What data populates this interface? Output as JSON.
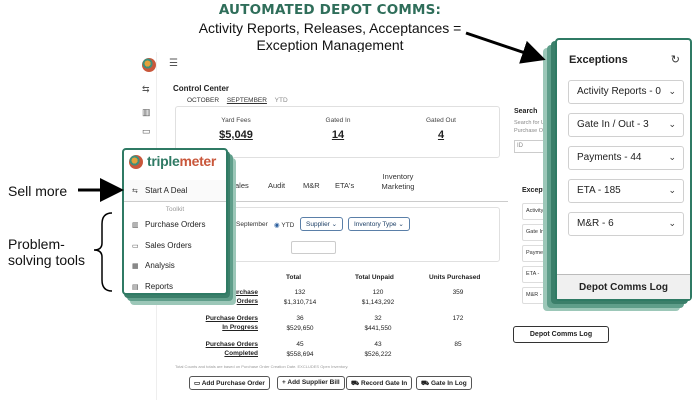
{
  "headline": {
    "title": "AUTOMATED DEPOT COMMS:",
    "line1": "Activity Reports, Releases, Acceptances =",
    "line2": "Exception Management"
  },
  "annotations": {
    "sell_more": "Sell more",
    "problem_line1": "Problem-",
    "problem_line2": "solving tools"
  },
  "colors": {
    "brand": "#2f7a64",
    "headline": "#2f6e5a",
    "accent_blue": "#5a7fa8"
  },
  "control_center": {
    "title": "Control Center",
    "period_tabs": [
      "OCTOBER",
      "SEPTEMBER",
      "YTD"
    ],
    "kpis": [
      {
        "label": "Yard Fees",
        "value": "$5,049"
      },
      {
        "label": "Gated In",
        "value": "14"
      },
      {
        "label": "Gated Out",
        "value": "4"
      }
    ],
    "tabs": [
      "Sales",
      "Audit",
      "M&R",
      "ETA's",
      "Inventory",
      "Marketing"
    ],
    "filters": {
      "radio_1": "September",
      "radio_2": "YTD",
      "dropdown_1": "Supplier",
      "dropdown_2": "Inventory Type"
    },
    "table": {
      "headers": [
        "Total",
        "Total Unpaid",
        "Units Purchased"
      ],
      "rows": [
        {
          "label_1": "Purchase",
          "label_2": "Orders",
          "total_count": "132",
          "total_amount": "$1,310,714",
          "unpaid_count": "120",
          "unpaid_amount": "$1,143,292",
          "units": "359"
        },
        {
          "label_1": "Purchase Orders",
          "label_2": "In Progress",
          "total_count": "36",
          "total_amount": "$529,650",
          "unpaid_count": "32",
          "unpaid_amount": "$441,550",
          "units": "172"
        },
        {
          "label_1": "Purchase Orders",
          "label_2": "Completed",
          "total_count": "45",
          "total_amount": "$558,694",
          "unpaid_count": "43",
          "unpaid_amount": "$526,222",
          "units": "85"
        }
      ],
      "note": "Total Counts and totals are based on Purchase Order Creation Date. EXCLUDES Open Inventory."
    },
    "actions": [
      "Add Purchase Order",
      "Add Supplier Bill",
      "Record Gate In",
      "Gate In Log"
    ]
  },
  "search": {
    "label": "Search",
    "sub_1": "Search for Un...",
    "sub_2": "Purchase Ord...",
    "placeholder": "ID"
  },
  "exceptions_partial": {
    "label": "Exceptions",
    "rows": [
      "Activity",
      "Gate In",
      "Payments",
      "ETA -",
      "M&R -"
    ]
  },
  "depot_comms_log_small": "Depot Comms Log",
  "exceptions": {
    "title": "Exceptions",
    "items": [
      "Activity Reports - 0",
      "Gate In / Out - 3",
      "Payments - 44",
      "ETA - 185",
      "M&R - 6"
    ],
    "log_button": "Depot Comms Log"
  },
  "toolkit": {
    "brand_a": "triple",
    "brand_b": "meter",
    "start": "Start A Deal",
    "subtitle": "Toolkit",
    "items": [
      "Purchase Orders",
      "Sales Orders",
      "Analysis",
      "Reports"
    ]
  }
}
